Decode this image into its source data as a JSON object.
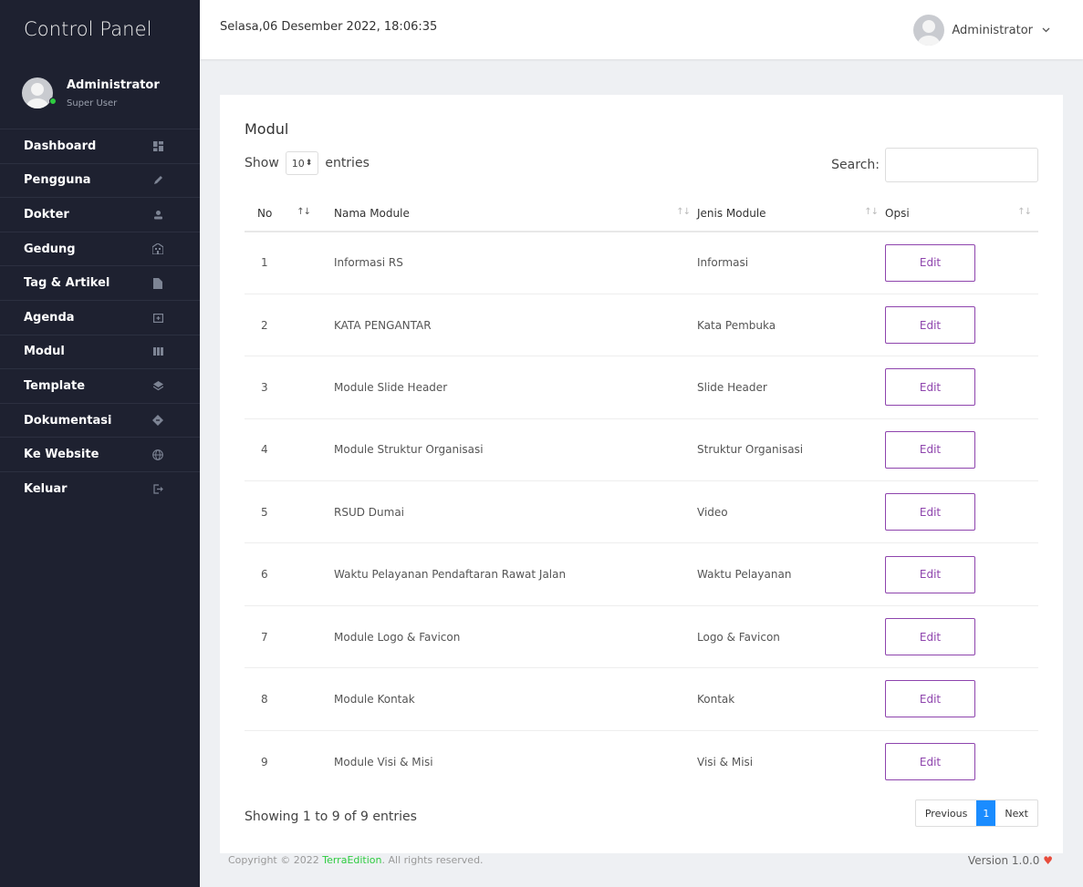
{
  "sidebar": {
    "brand": "Control Panel",
    "profile": {
      "name": "Administrator",
      "role": "Super User"
    },
    "items": [
      {
        "label": "Dashboard",
        "icon": "dashboard-icon"
      },
      {
        "label": "Pengguna",
        "icon": "pencil-icon"
      },
      {
        "label": "Dokter",
        "icon": "user-icon"
      },
      {
        "label": "Gedung",
        "icon": "building-icon"
      },
      {
        "label": "Tag & Artikel",
        "icon": "file-icon"
      },
      {
        "label": "Agenda",
        "icon": "calendar-icon"
      },
      {
        "label": "Modul",
        "icon": "columns-icon"
      },
      {
        "label": "Template",
        "icon": "layers-icon"
      },
      {
        "label": "Dokumentasi",
        "icon": "diamond-icon"
      },
      {
        "label": "Ke Website",
        "icon": "globe-icon"
      },
      {
        "label": "Keluar",
        "icon": "logout-icon"
      }
    ]
  },
  "topbar": {
    "datetime": "Selasa,06 Desember 2022, 18:06:35",
    "user": "Administrator"
  },
  "card": {
    "title": "Modul",
    "show_label": "Show",
    "entries_value": "10",
    "entries_label": "entries",
    "search_label": "Search:",
    "search_value": "",
    "columns": [
      "No",
      "Nama Module",
      "Jenis Module",
      "Opsi"
    ],
    "rows": [
      {
        "no": "1",
        "nama": "Informasi RS",
        "jenis": "Informasi",
        "action": "Edit"
      },
      {
        "no": "2",
        "nama": "KATA PENGANTAR",
        "jenis": "Kata Pembuka",
        "action": "Edit"
      },
      {
        "no": "3",
        "nama": "Module Slide Header",
        "jenis": "Slide Header",
        "action": "Edit"
      },
      {
        "no": "4",
        "nama": "Module Struktur Organisasi",
        "jenis": "Struktur Organisasi",
        "action": "Edit"
      },
      {
        "no": "5",
        "nama": "RSUD Dumai",
        "jenis": "Video",
        "action": "Edit"
      },
      {
        "no": "6",
        "nama": "Waktu Pelayanan Pendaftaran Rawat Jalan",
        "jenis": "Waktu Pelayanan",
        "action": "Edit"
      },
      {
        "no": "7",
        "nama": "Module Logo & Favicon",
        "jenis": "Logo & Favicon",
        "action": "Edit"
      },
      {
        "no": "8",
        "nama": "Module Kontak",
        "jenis": "Kontak",
        "action": "Edit"
      },
      {
        "no": "9",
        "nama": "Module Visi & Misi",
        "jenis": "Visi & Misi",
        "action": "Edit"
      }
    ],
    "info": "Showing 1 to 9 of 9 entries",
    "pagination": {
      "previous": "Previous",
      "current": "1",
      "next": "Next"
    }
  },
  "footer": {
    "copyright_prefix": "Copyright © 2022 ",
    "brand": "TerraEdition",
    "copyright_suffix": ". All rights reserved.",
    "version": "Version 1.0.0"
  },
  "colors": {
    "sidebar_bg": "#1e2130",
    "accent_purple": "#8e44ad",
    "pager_active": "#1a8cff",
    "online_green": "#2ecc40",
    "heart_red": "#e74c3c"
  }
}
